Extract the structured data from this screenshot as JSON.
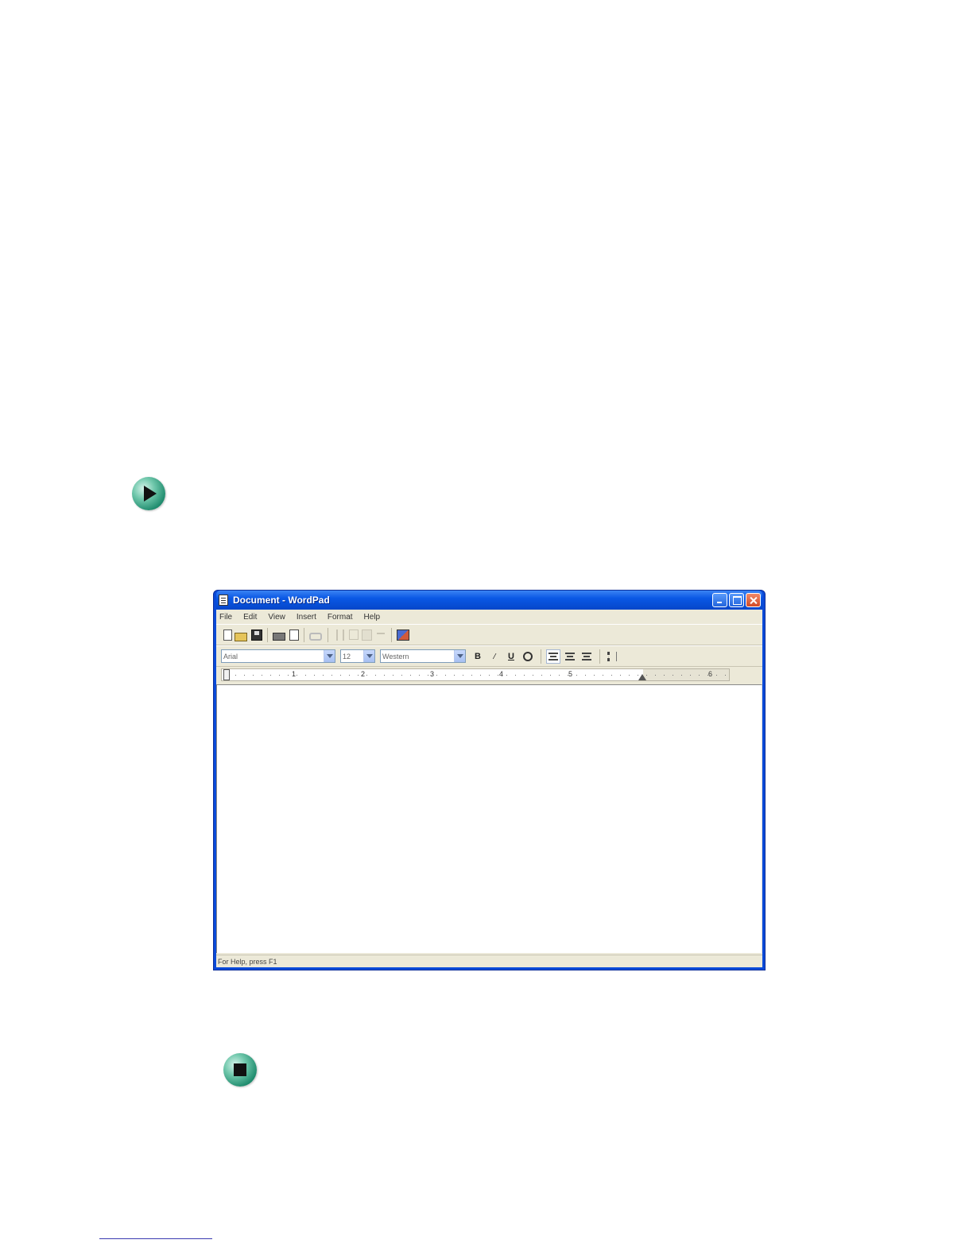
{
  "window": {
    "title": "Document - WordPad"
  },
  "menu": {
    "items": [
      "File",
      "Edit",
      "View",
      "Insert",
      "Format",
      "Help"
    ]
  },
  "format_bar": {
    "font": "Arial",
    "size": "12",
    "script": "Western",
    "bold": "B",
    "italic": "/",
    "underline": "U"
  },
  "ruler": {
    "numbers": [
      "1",
      "2",
      "3",
      "4",
      "5",
      "6"
    ]
  },
  "status": {
    "text": "For Help, press F1"
  },
  "icons": {
    "play": "play-icon",
    "stop": "stop-icon"
  }
}
